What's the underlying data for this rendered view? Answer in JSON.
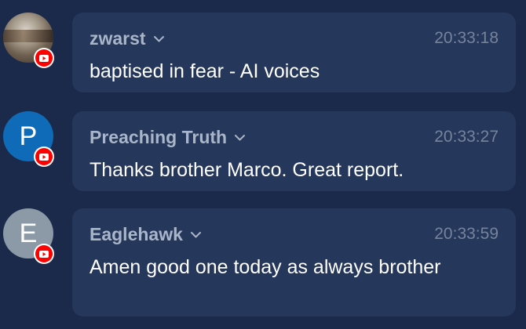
{
  "colors": {
    "background": "#1b2a4a",
    "bubble": "#25375a",
    "author_text": "#a9b5c8",
    "time_text": "#75839b",
    "message_text": "#ffffff",
    "youtube_red": "#ff0000"
  },
  "messages": [
    {
      "author": "zwarst",
      "time": "20:33:18",
      "text": "baptised in fear - AI voices",
      "avatar_type": "photo",
      "platform_icon": "youtube-icon"
    },
    {
      "author": "Preaching Truth",
      "time": "20:33:27",
      "text": "Thanks brother Marco. Great report.",
      "avatar_letter": "P",
      "avatar_color": "#0f6bb8",
      "platform_icon": "youtube-icon"
    },
    {
      "author": "Eaglehawk",
      "time": "20:33:59",
      "text": "Amen good one today as always brother",
      "avatar_letter": "E",
      "avatar_color": "#8b9aa6",
      "platform_icon": "youtube-icon"
    }
  ]
}
